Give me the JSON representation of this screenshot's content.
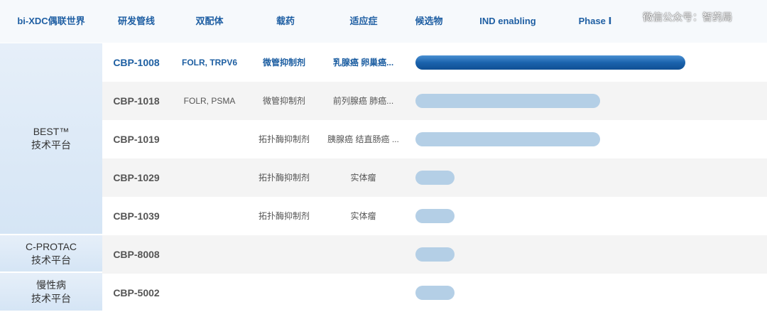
{
  "header": {
    "cols": [
      "bi-XDC偶联世界",
      "研发管线",
      "双配体",
      "载药",
      "适应症",
      "候选物",
      "IND enabling",
      "Phase Ⅰ"
    ],
    "watermark": "微信公众号：智药局"
  },
  "platforms": [
    {
      "label": "BEST™\n技术平台"
    },
    {
      "label": "C-PROTAC\n技术平台"
    },
    {
      "label": "慢性病\n技术平台"
    }
  ],
  "rows": [
    {
      "code": "CBP-1008",
      "ligand": "FOLR, TRPV6",
      "payload": "微管抑制剂",
      "indication": "乳腺癌 卵巢癌...",
      "progress": 0.76,
      "highlight": true
    },
    {
      "code": "CBP-1018",
      "ligand": "FOLR, PSMA",
      "payload": "微管抑制剂",
      "indication": "前列腺癌 肺癌...",
      "progress": 0.52,
      "highlight": false
    },
    {
      "code": "CBP-1019",
      "ligand": "",
      "payload": "拓扑酶抑制剂",
      "indication": "胰腺癌 结直肠癌 ...",
      "progress": 0.52,
      "highlight": false
    },
    {
      "code": "CBP-1029",
      "ligand": "",
      "payload": "拓扑酶抑制剂",
      "indication": "实体瘤",
      "progress": 0.11,
      "highlight": false
    },
    {
      "code": "CBP-1039",
      "ligand": "",
      "payload": "拓扑酶抑制剂",
      "indication": "实体瘤",
      "progress": 0.11,
      "highlight": false
    },
    {
      "code": "CBP-8008",
      "ligand": "",
      "payload": "",
      "indication": "",
      "progress": 0.11,
      "highlight": false
    },
    {
      "code": "CBP-5002",
      "ligand": "",
      "payload": "",
      "indication": "",
      "progress": 0.11,
      "highlight": false
    }
  ],
  "colors": {
    "header_text": "#1f5fa3",
    "highlight_text": "#1e5fa2",
    "bar_light": "#b4cfe6",
    "bar_dark": "#1b63ad",
    "platform_bg": "#dbe8f6"
  }
}
